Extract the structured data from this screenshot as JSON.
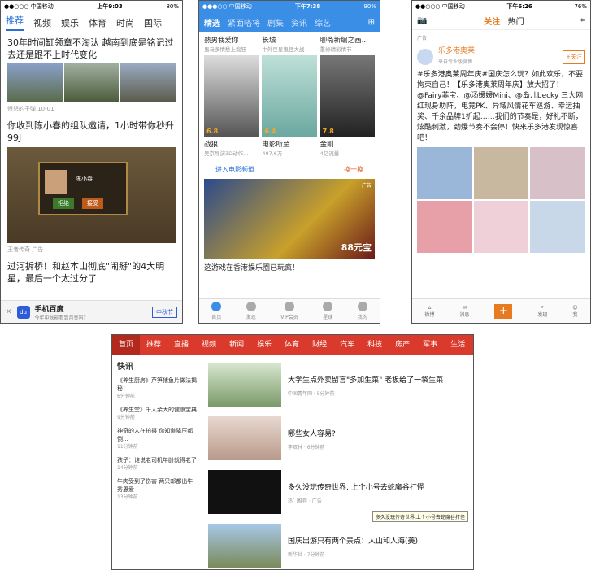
{
  "p1": {
    "carrier": "●●○○○ 中国移动",
    "time": "上午9:03",
    "battery": "80%",
    "tabs": [
      "推荐",
      "视频",
      "娱乐",
      "体育",
      "时尚",
      "国际"
    ],
    "n1_title": "30年时间缸领章不淘汰 越南到底是铭记过去还是跟不上时代变化",
    "n1_meta": "愤怒的子弹  10-01",
    "n2_title": "你收到陈小春的组队邀请，1小时带你秒升99J",
    "n2_meta": "王者传奇  广告",
    "dlg_name": "陈小春",
    "dlg_btn1": "拒绝",
    "dlg_btn2": "接受",
    "n3_title": "过河拆桥！和赵本山彻底\"闹掰\"的4大明星，最后一个太过分了",
    "ad_name": "手机百度",
    "ad_sub": "今年中秋能看到月亮吗？",
    "ad_btn": "中秋节"
  },
  "p2": {
    "carrier": "●●●○○ 中国移动",
    "time": "下午7:38",
    "battery": "90%",
    "nav": [
      "精选",
      "紧面嗒将",
      "剧集",
      "资讯",
      "综艺"
    ],
    "movies": [
      {
        "h": "熟男我爱你",
        "s": "鬼马多情愁上痴狂",
        "score": "6.8",
        "name": "战狼",
        "sub": "吴京导演3D动作..."
      },
      {
        "h": "长城",
        "s": "中外巨星鬼怪大战",
        "score": "6.4",
        "name": "电影所至",
        "sub": "497.6万"
      },
      {
        "h": "聊斋新编之画...",
        "s": "重修精彩情节",
        "score": "7.8",
        "name": "金刚",
        "sub": "4亿流量"
      }
    ],
    "link1": "进入电影频道",
    "link2": "换一换",
    "banner_badge": "广告",
    "banner_price": "88元宝",
    "banner_title": "这游戏在香港娱乐圈已玩疯！",
    "bnav": [
      "首页",
      "发现",
      "VIP会员",
      "星球",
      "我的"
    ]
  },
  "p3": {
    "carrier": "●●○○○ 中国移动",
    "time": "下午6:26",
    "battery": "76%",
    "tab1": "关注",
    "tab2": "热门",
    "ad": "广告",
    "user": "乐多港奥莱",
    "usersub": "来自专业版微博",
    "follow": "+关注",
    "post": "#乐多港奥莱周年庆#国庆怎么玩？如此欢乐，不要拘束自己！【乐多港奥莱周年庆】放大招了！@Fairy菲宝、@汤媛媛Mini、@岛儿becky 三大网红现身助阵，电竞PK、异域风情花车巡游、幸运抽奖、千余品牌1折起……我们的节奏是，好礼不断，炫酷刺激，劲爆节奏不会停！快来乐多港发现惊喜吧！",
    "bnav": [
      "微博",
      "消息",
      "+",
      "发现",
      "我"
    ]
  },
  "web": {
    "nav": [
      "首页",
      "推荐",
      "直播",
      "视频",
      "新闻",
      "娱乐",
      "体育",
      "财经",
      "汽车",
      "科技",
      "房产",
      "军事",
      "生活",
      "社会"
    ],
    "kuaixun": "快讯",
    "left": [
      {
        "t": "《养生厨房》芦笋猪鱼片做法揭秘！",
        "m": "6分钟前"
      },
      {
        "t": "《养生堂》千人余大的健康宝典",
        "m": "9分钟前"
      },
      {
        "t": "神奇的人在拍摄 你知道降压都倒...",
        "m": "11分钟前"
      },
      {
        "t": "孩子：谁说老司机年龄就得老了",
        "m": "14分钟前"
      },
      {
        "t": "牛肉受到了伤害 两只邮都出牛秀恩爱",
        "m": "13分钟前"
      }
    ],
    "feed": [
      {
        "t": "大学生点外卖留言\"多加生菜\" 老板给了一袋生菜",
        "m": "中国青年网 · 5分钟前"
      },
      {
        "t": "哪些女人容易?",
        "m": "李双林 · 6分钟前"
      },
      {
        "t": "多久没玩传奇世界, 上个小号去蛇魔谷打怪",
        "m": "热门推荐 · 广告"
      },
      {
        "t": "国庆出游只有两个景点：人山和人海(美)",
        "m": "新华社 · 7分钟前"
      }
    ],
    "tip": "多久没玩传奇世界,上个小号去蛇魔谷打怪"
  }
}
